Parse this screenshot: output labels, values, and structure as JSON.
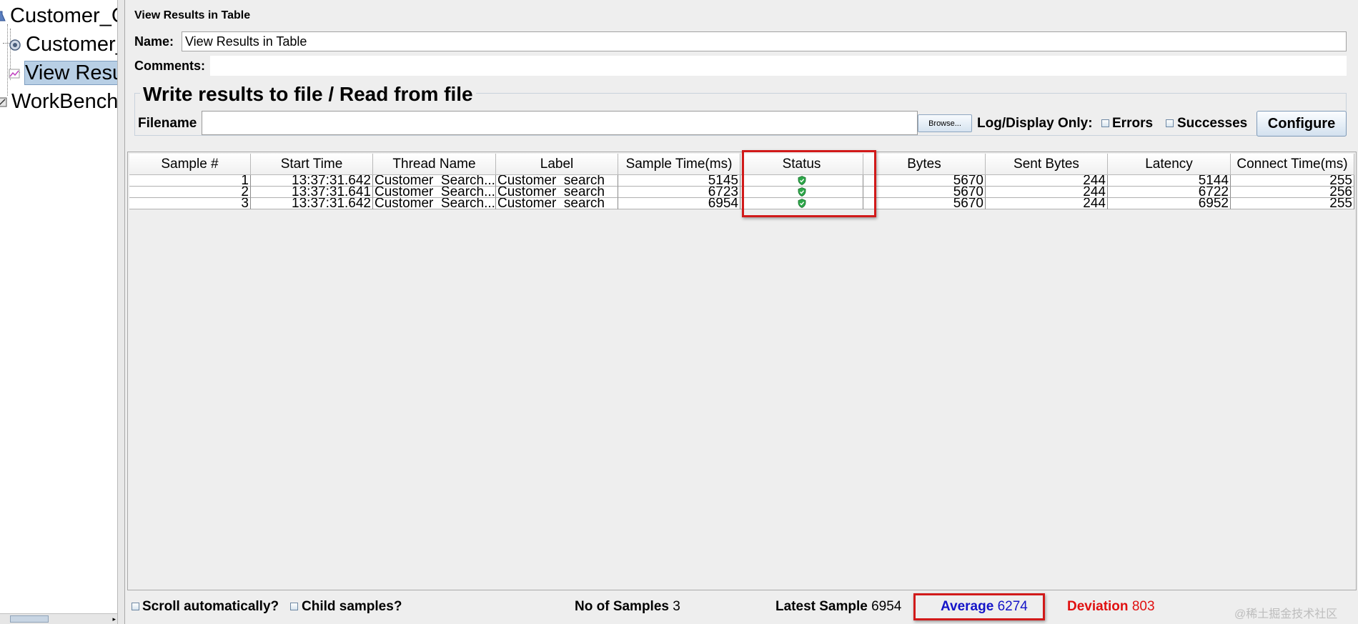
{
  "tree": {
    "items": [
      {
        "label": "Customer_C"
      },
      {
        "label": "Customer_"
      },
      {
        "label": "View Resu"
      },
      {
        "label": "WorkBench"
      }
    ]
  },
  "panel": {
    "title": "View Results in Table",
    "name_label": "Name:",
    "name_value": "View Results in Table",
    "comments_label": "Comments:",
    "file_section_title": "Write results to file / Read from file",
    "filename_label": "Filename",
    "browse_label": "Browse...",
    "log_display_label": "Log/Display Only:",
    "errors_label": "Errors",
    "successes_label": "Successes",
    "configure_label": "Configure"
  },
  "table": {
    "columns": [
      "Sample #",
      "Start Time",
      "Thread Name",
      "Label",
      "Sample Time(ms)",
      "Status",
      "Bytes",
      "Sent Bytes",
      "Latency",
      "Connect Time(ms)"
    ],
    "rows": [
      {
        "sample": "1",
        "start_time": "13:37:31.642",
        "thread_name": "Customer_Search...",
        "label": "Customer_search",
        "sample_time": "5145",
        "status": "success",
        "bytes": "5670",
        "sent_bytes": "244",
        "latency": "5144",
        "connect_time": "255"
      },
      {
        "sample": "2",
        "start_time": "13:37:31.641",
        "thread_name": "Customer_Search...",
        "label": "Customer_search",
        "sample_time": "6723",
        "status": "success",
        "bytes": "5670",
        "sent_bytes": "244",
        "latency": "6722",
        "connect_time": "256"
      },
      {
        "sample": "3",
        "start_time": "13:37:31.642",
        "thread_name": "Customer_Search...",
        "label": "Customer_search",
        "sample_time": "6954",
        "status": "success",
        "bytes": "5670",
        "sent_bytes": "244",
        "latency": "6952",
        "connect_time": "255"
      }
    ]
  },
  "footer": {
    "scroll_label": "Scroll automatically?",
    "child_samples_label": "Child samples?",
    "no_of_samples_label": "No of Samples",
    "no_of_samples_value": "3",
    "latest_sample_label": "Latest Sample",
    "latest_sample_value": "6954",
    "average_label": "Average",
    "average_value": "6274",
    "deviation_label": "Deviation",
    "deviation_value": "803"
  },
  "watermark": "@稀土掘金技术社区",
  "colors": {
    "average": "#1414c8",
    "deviation": "#e01010",
    "highlight_box": "#d11a1a",
    "selection": "#b8cfe5"
  },
  "icons": [
    "test-plan-icon",
    "thread-group-icon",
    "listener-icon",
    "workbench-icon",
    "success-shield-icon"
  ]
}
